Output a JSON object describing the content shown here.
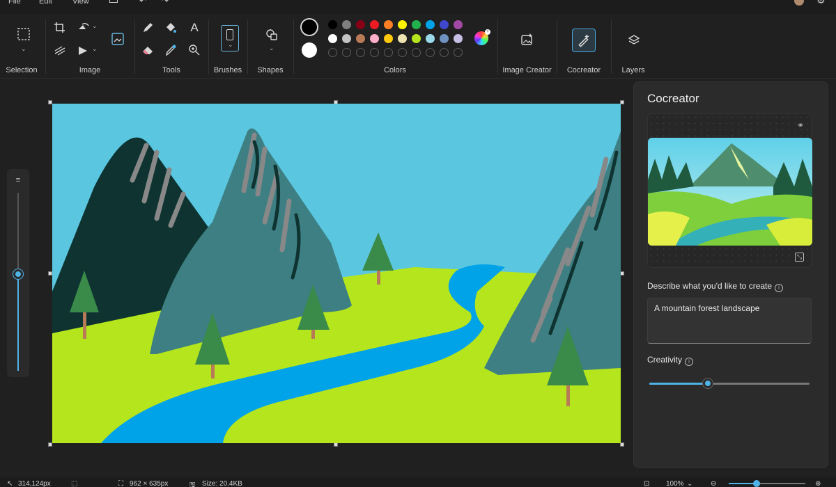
{
  "menu": {
    "file": "File",
    "edit": "Edit",
    "view": "View"
  },
  "ribbon": {
    "groups": {
      "selection": "Selection",
      "image": "Image",
      "tools": "Tools",
      "brushes": "Brushes",
      "shapes": "Shapes",
      "colors": "Colors",
      "image_creator": "Image Creator",
      "cocreator": "Cocreator",
      "layers": "Layers"
    },
    "primary_color": "#000000",
    "secondary_color": "#ffffff",
    "palette_row1": [
      "#000000",
      "#7f7f7f",
      "#880015",
      "#ed1c24",
      "#ff7f27",
      "#fff200",
      "#22b14c",
      "#00a2e8",
      "#3f48cc",
      "#a349a4"
    ],
    "palette_row2": [
      "#ffffff",
      "#c3c3c3",
      "#b97a57",
      "#ffaec9",
      "#ffc90e",
      "#efe4b0",
      "#b5e61d",
      "#99d9ea",
      "#7092be",
      "#c8bfe7"
    ]
  },
  "canvas": {
    "colors": {
      "sky": "#5bc6e0",
      "grass": "#b5e61d",
      "river": "#00a2e8",
      "mountain_dark": "#0e3331",
      "mountain_teal": "#3d7f82",
      "tree": "#3a8a4a",
      "trunk": "#b97a57",
      "snow_stroke": "#888888"
    }
  },
  "cocreator": {
    "title": "Cocreator",
    "describe_label": "Describe what you'd like to create",
    "prompt_value": "A mountain forest landscape",
    "creativity_label": "Creativity",
    "creativity_level": 0.37
  },
  "status": {
    "cursor_pos": "314,124px",
    "canvas_size": "962 × 635px",
    "file_size": "Size: 20.4KB",
    "zoom": "100%"
  },
  "accent": "#4fb3e8"
}
